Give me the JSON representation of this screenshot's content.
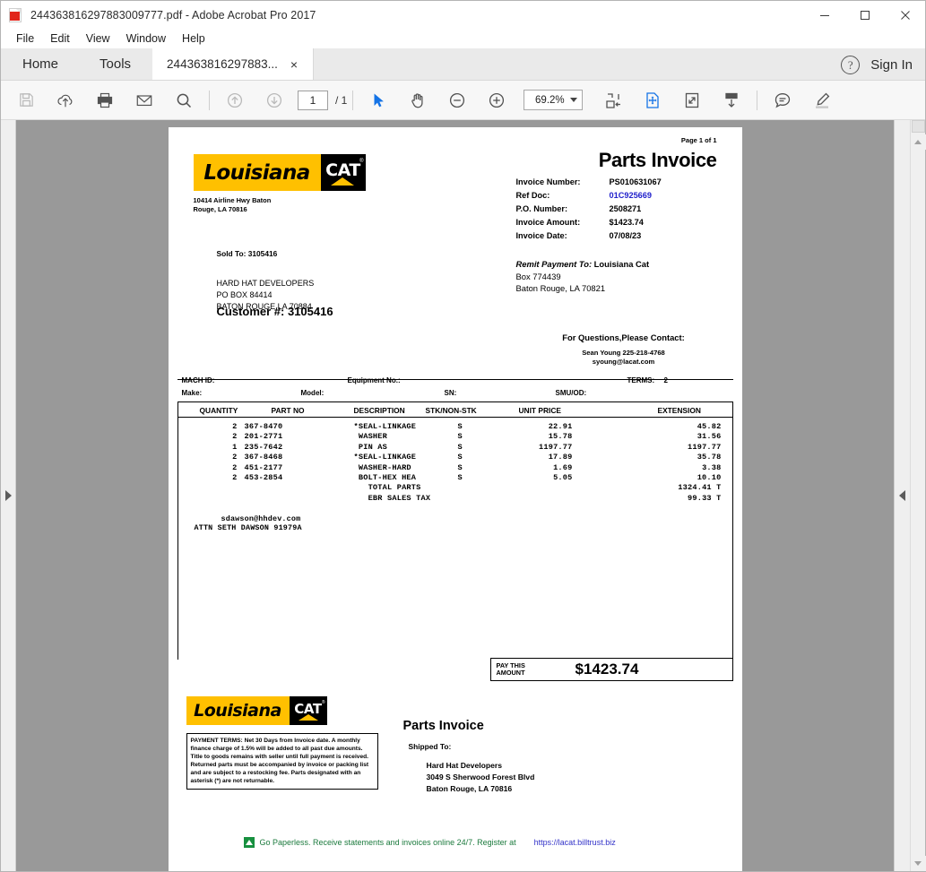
{
  "window": {
    "title": "244363816297883009777.pdf - Adobe Acrobat Pro 2017",
    "minimize_label": "Minimize",
    "maximize_label": "Maximize",
    "close_label": "Close"
  },
  "menu": {
    "items": [
      "File",
      "Edit",
      "View",
      "Window",
      "Help"
    ]
  },
  "tabs": {
    "home": "Home",
    "tools": "Tools",
    "document": "244363816297883...",
    "close_x": "×",
    "help": "?",
    "sign_in": "Sign In"
  },
  "toolbar": {
    "icons": [
      "save-icon",
      "upload-cloud-icon",
      "print-icon",
      "email-icon",
      "search-icon",
      "previous-page-icon",
      "next-page-icon",
      "select-tool-icon",
      "hand-tool-icon",
      "zoom-out-icon",
      "zoom-in-icon",
      "fit-width-icon",
      "fit-page-icon",
      "fullscreen-icon",
      "scroll-mode-icon",
      "comment-icon",
      "highlight-icon"
    ],
    "page_value": "1",
    "page_total": "/ 1",
    "zoom_value": "69.2%"
  },
  "document": {
    "page_of": "Page 1 of 1",
    "title": "Parts Invoice",
    "company": {
      "logo_word": "Louisiana",
      "logo_cat": "CAT",
      "address_line1": "10414 Airline Hwy Baton",
      "address_line2": "Rouge, LA 70816"
    },
    "fields": [
      {
        "label": "Invoice Number:",
        "value": "PS010631067",
        "link": false
      },
      {
        "label": "Ref Doc:",
        "value": "01C925669",
        "link": true
      },
      {
        "label": "P.O. Number:",
        "value": "2508271",
        "link": false
      },
      {
        "label": "Invoice Amount:",
        "value": "$1423.74",
        "link": false
      },
      {
        "label": "Invoice Date:",
        "value": "07/08/23",
        "link": false
      }
    ],
    "sold_to_label": "Sold To:  3105416",
    "sold_to_address": "HARD HAT DEVELOPERS\nPO BOX 84414\nBATON ROUGE LA 70884",
    "customer_number": "Customer #:  3105416",
    "remit": {
      "label": "Remit Payment To:",
      "name": "Louisiana Cat",
      "line2": "Box 774439",
      "line3": "Baton Rouge, LA 70821"
    },
    "questions_heading": "For Questions,Please Contact:",
    "contact_name_phone": "Sean Young 225-218-4768",
    "contact_email": "syoung@lacat.com",
    "info_row1": {
      "mach_id": "MACH ID:",
      "equipment_no": "Equipment No.:",
      "terms_label": "TERMS:",
      "terms_value": "2"
    },
    "info_row2": {
      "make": "Make:",
      "model": "Model:",
      "sn": "SN:",
      "smuod": "SMU/OD:"
    },
    "table": {
      "columns": [
        "QUANTITY",
        "PART NO",
        "DESCRIPTION",
        "STK/NON-STK",
        "UNIT PRICE",
        "EXTENSION"
      ],
      "rows": [
        {
          "qty": "2",
          "part_no": "367-8470",
          "description": "*SEAL-LINKAGE",
          "stk": "S",
          "unit_price": "22.91",
          "extension": "45.82"
        },
        {
          "qty": "2",
          "part_no": "201-2771",
          "description": " WASHER",
          "stk": "S",
          "unit_price": "15.78",
          "extension": "31.56"
        },
        {
          "qty": "1",
          "part_no": "235-7642",
          "description": " PIN AS",
          "stk": "S",
          "unit_price": "1197.77",
          "extension": "1197.77"
        },
        {
          "qty": "2",
          "part_no": "367-8468",
          "description": "*SEAL-LINKAGE",
          "stk": "S",
          "unit_price": "17.89",
          "extension": "35.78"
        },
        {
          "qty": "2",
          "part_no": "451-2177",
          "description": " WASHER-HARD",
          "stk": "S",
          "unit_price": "1.69",
          "extension": "3.38"
        },
        {
          "qty": "2",
          "part_no": "453-2854",
          "description": " BOLT-HEX HEA",
          "stk": "S",
          "unit_price": "5.05",
          "extension": "10.10"
        },
        {
          "qty": "",
          "part_no": "",
          "description": "   TOTAL PARTS",
          "stk": "",
          "unit_price": "",
          "extension": "1324.41 T"
        },
        {
          "qty": "",
          "part_no": "",
          "description": "   EBR SALES TAX",
          "stk": "",
          "unit_price": "",
          "extension": "99.33 T"
        }
      ],
      "note_email": "sdawson@hhdev.com",
      "note_attn": "ATTN SETH DAWSON 91979A"
    },
    "pay_this": {
      "label_line1": "PAY THIS",
      "label_line2": "AMOUNT",
      "amount": "$1423.74"
    },
    "stub": {
      "logo_word": "Louisiana",
      "logo_cat": "CAT",
      "terms_text": "PAYMENT TERMS: Net 30 Days from Invoice date. A monthly finance charge of 1.5% will be added to all past due amounts. Title to goods remains with seller until full payment is received. Returned parts must be accompanied by invoice or packing list and are subject to a restocking fee. Parts designated with an asterisk (*) are not returnable.",
      "title": "Parts Invoice",
      "shipped_to_label": "Shipped To:",
      "shipped_to_address": "Hard Hat Developers\n3049 S Sherwood Forest Blvd\nBaton Rouge, LA 70816"
    },
    "paperless": {
      "text": "Go Paperless.  Receive statements and invoices online 24/7. Register at",
      "url": "https://lacat.billtrust.biz"
    }
  },
  "colors": {
    "cat_yellow": "#FFC000",
    "link_blue": "#2222CC",
    "paperless_green": "#1B7A3D",
    "accent_blue": "#1473E6"
  }
}
